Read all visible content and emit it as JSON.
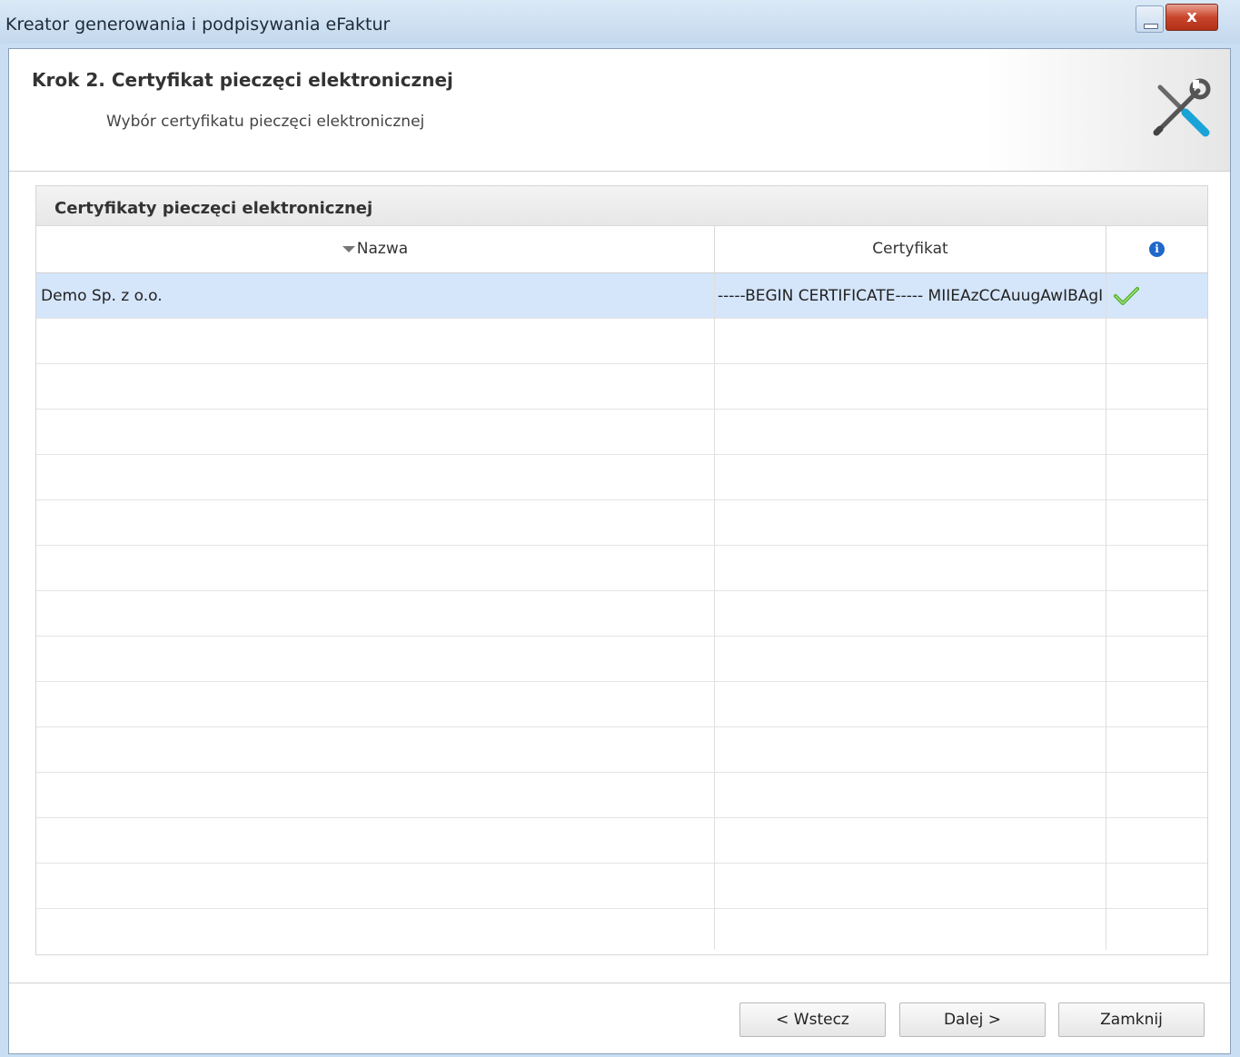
{
  "window": {
    "title": "Kreator generowania i podpisywania eFaktur",
    "close_label": "x"
  },
  "header": {
    "step_title": "Krok 2. Certyfikat pieczęci elektronicznej",
    "step_subtitle": "Wybór certyfikatu pieczęci elektronicznej"
  },
  "panel": {
    "title": "Certyfikaty pieczęci elektronicznej",
    "columns": {
      "name": "Nazwa",
      "certificate": "Certyfikat",
      "info": "i"
    },
    "rows": [
      {
        "name": "Demo Sp. z o.o.",
        "certificate": "-----BEGIN CERTIFICATE----- MIIEAzCCAuugAwIBAgI",
        "valid": true
      }
    ]
  },
  "buttons": {
    "back": "< Wstecz",
    "next": "Dalej >",
    "close": "Zamknij"
  },
  "colors": {
    "selected_row": "#d5e6fb",
    "check": "#4caf1f",
    "info_icon": "#1f67c9"
  }
}
